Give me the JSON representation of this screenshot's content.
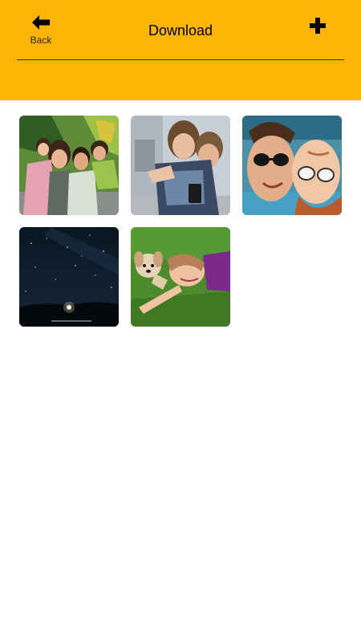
{
  "header": {
    "title": "Download",
    "back_label": "Back",
    "background": "#FDB503",
    "back_icon": "arrow-left-icon",
    "add_icon": "plus-icon"
  },
  "gallery": {
    "photos": [
      {
        "subject": "family-photo"
      },
      {
        "subject": "couple-photo"
      },
      {
        "subject": "sunglasses-selfie-photo"
      },
      {
        "subject": "night-sky-photo"
      },
      {
        "subject": "girl-with-dog-photo"
      }
    ]
  }
}
